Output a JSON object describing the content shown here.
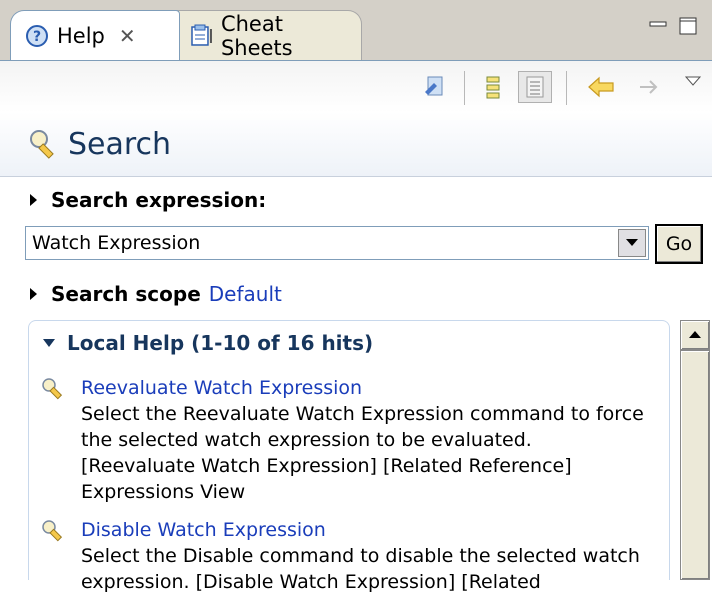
{
  "tabs": {
    "help_label": "Help",
    "cheat_label": "Cheat Sheets"
  },
  "header": {
    "title": "Search"
  },
  "search_expression": {
    "label": "Search expression:",
    "value": "Watch Expression",
    "go_label": "Go"
  },
  "search_scope": {
    "label": "Search scope",
    "value": "Default"
  },
  "results": {
    "heading": "Local Help (1-10 of 16 hits)",
    "hits": [
      {
        "title": "Reevaluate Watch Expression",
        "description": "Select the Reevaluate Watch Expression command to force the selected watch expression to be evaluated. [Reevaluate Watch Expression] [Related Reference] Expressions View"
      },
      {
        "title": "Disable Watch Expression",
        "description": "Select the Disable command to disable the selected watch expression. [Disable Watch Expression] [Related"
      }
    ]
  },
  "colors": {
    "link": "#1a3dba",
    "heading": "#17365d",
    "chrome": "#d4d0c8"
  }
}
